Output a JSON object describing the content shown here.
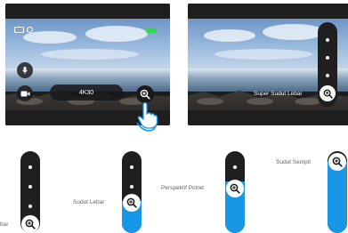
{
  "panels": {
    "left": {
      "resolution_label": "4K30",
      "icons": [
        "camera-status-icon",
        "mic-icon",
        "video-camera-icon",
        "zoom-in-icon",
        "hand-pointer-icon"
      ],
      "battery_color": "#35d35a"
    },
    "right": {
      "zoom_mode_label": "Super Sudut Lebar"
    }
  },
  "zoom_steps": [
    {
      "label": "bar",
      "level": "super-wide"
    },
    {
      "label": "Sudut Lebar",
      "level": "wide"
    },
    {
      "label": "Perspektif Potret",
      "level": "portrait"
    },
    {
      "label": "Sudut Sempit",
      "level": "narrow"
    }
  ],
  "colors": {
    "accent": "#1797e6",
    "panel_background": "#1c1c1c"
  }
}
